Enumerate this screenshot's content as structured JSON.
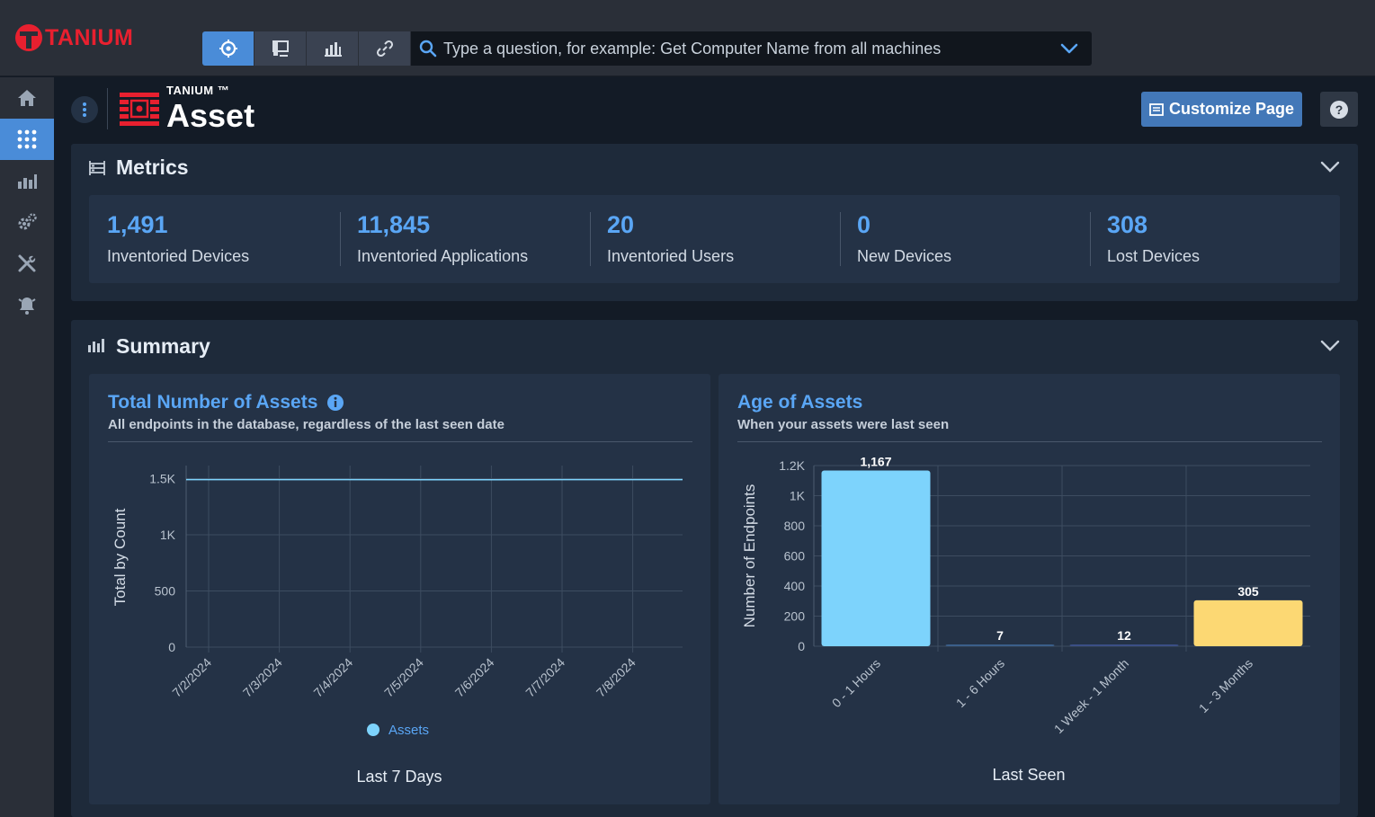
{
  "app": {
    "brand": "TANIUM"
  },
  "search": {
    "placeholder": "Type a question, for example: Get Computer Name from all machines"
  },
  "toolbar": {
    "buttons": [
      {
        "icon": "target-icon",
        "active": true
      },
      {
        "icon": "interact-icon",
        "active": false
      },
      {
        "icon": "reports-icon",
        "active": false
      },
      {
        "icon": "link-icon",
        "active": false
      }
    ]
  },
  "sidebar": {
    "items": [
      {
        "icon": "home-icon",
        "active": false
      },
      {
        "icon": "modules-grid-icon",
        "active": true
      },
      {
        "icon": "bar-chart-icon",
        "active": false
      },
      {
        "icon": "gears-icon",
        "active": false
      },
      {
        "icon": "tools-icon",
        "active": false
      },
      {
        "icon": "alarm-bell-icon",
        "active": false
      }
    ]
  },
  "header": {
    "module_brand": "TANIUM ™",
    "module_title": "Asset",
    "customize_label": "Customize Page",
    "help_label": "?"
  },
  "metrics": {
    "title": "Metrics",
    "items": [
      {
        "value": "1,491",
        "label": "Inventoried Devices"
      },
      {
        "value": "11,845",
        "label": "Inventoried Applications"
      },
      {
        "value": "20",
        "label": "Inventoried Users"
      },
      {
        "value": "0",
        "label": "New Devices"
      },
      {
        "value": "308",
        "label": "Lost Devices"
      }
    ]
  },
  "summary": {
    "title": "Summary"
  },
  "colors": {
    "accent": "#4a8cd8",
    "series_blue": "#7dd3fc",
    "series_yellow": "#fcd873",
    "link_blue": "#5aa6f5"
  },
  "chart_data": [
    {
      "type": "line",
      "title": "Total Number of Assets",
      "subtitle": "All endpoints in the database, regardless of the last seen date",
      "xlabel": "Last 7 Days",
      "ylabel": "Total by Count",
      "x": [
        "7/2/2024",
        "7/3/2024",
        "7/4/2024",
        "7/5/2024",
        "7/6/2024",
        "7/7/2024",
        "7/8/2024"
      ],
      "series": [
        {
          "name": "Assets",
          "values": [
            1491,
            1491,
            1491,
            1490,
            1490,
            1491,
            1491
          ]
        }
      ],
      "yticks": [
        "0",
        "500",
        "1K",
        "1.5K"
      ],
      "ytick_values": [
        0,
        500,
        1000,
        1500
      ],
      "ylim": [
        0,
        1600
      ],
      "grid": true,
      "legend": "bottom"
    },
    {
      "type": "bar",
      "title": "Age of Assets",
      "subtitle": "When your assets were last seen",
      "xlabel": "Last Seen",
      "ylabel": "Number of Endpoints",
      "categories": [
        "0 - 1 Hours",
        "1 - 6 Hours",
        "1 Week - 1 Month",
        "1 - 3 Months"
      ],
      "values": [
        1167,
        7,
        12,
        305
      ],
      "value_labels": [
        "1,167",
        "7",
        "12",
        "305"
      ],
      "colors": [
        "#7dd3fc",
        "#3b5f8a",
        "#3b4f86",
        "#fcd873"
      ],
      "yticks": [
        "0",
        "200",
        "400",
        "600",
        "800",
        "1K",
        "1.2K"
      ],
      "ytick_values": [
        0,
        200,
        400,
        600,
        800,
        1000,
        1200
      ],
      "ylim": [
        0,
        1200
      ],
      "grid": true
    }
  ]
}
